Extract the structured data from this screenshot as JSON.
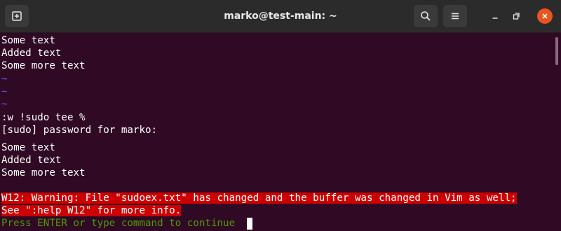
{
  "window": {
    "title": "marko@test-main: ~",
    "accent_color": "#e95420"
  },
  "icons": {
    "new_tab": "new-tab-icon",
    "search": "search-icon",
    "menu": "hamburger-menu-icon",
    "minimize": "minimize-icon",
    "restore": "restore-icon",
    "close": "close-icon"
  },
  "terminal": {
    "lines": [
      "Some text",
      "Added text",
      "Some more text",
      "~",
      "~",
      "~",
      ":w !sudo tee %",
      "[sudo] password for marko:",
      "Some text",
      "Added text",
      "Some more text",
      "W12: Warning: File \"sudoex.txt\" has changed and the buffer was changed in Vim as well;",
      "See \":help W12\" for more info.",
      "Press ENTER or type command to continue"
    ],
    "colors": {
      "background": "#300a24",
      "text": "#ffffff",
      "tilde": "#5c5cff",
      "error_bg": "#cc0000",
      "prompt": "#4e9a06"
    }
  }
}
